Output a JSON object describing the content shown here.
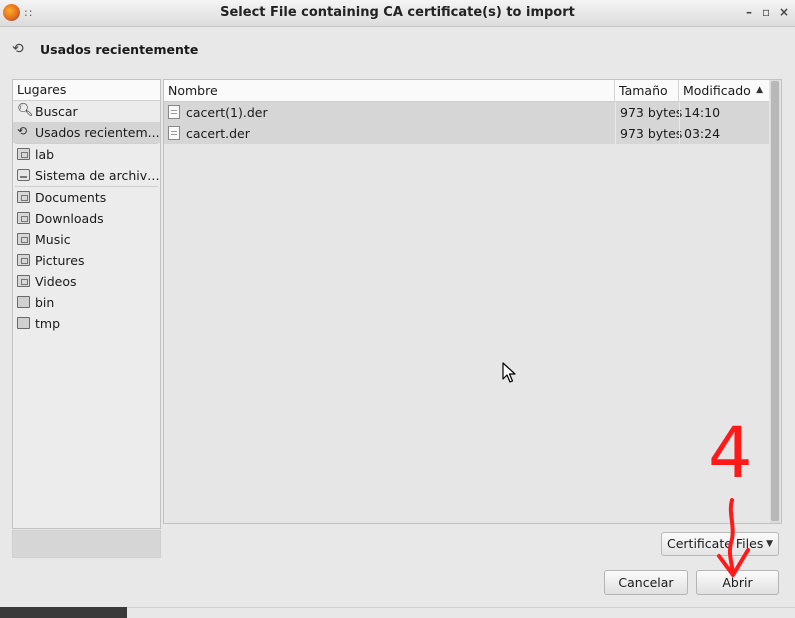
{
  "window": {
    "title": "Select File containing CA certificate(s) to import",
    "grip": "::",
    "controls": {
      "minimize": "–",
      "maximize": "▫",
      "close": "×"
    }
  },
  "location": {
    "icon": "recent-icon",
    "label": "Usados recientemente"
  },
  "places": {
    "header": "Lugares",
    "items": [
      {
        "label": "Buscar",
        "icon": "search-icon"
      },
      {
        "label": "Usados recientem...",
        "icon": "recent-icon",
        "selected": true
      },
      {
        "label": "lab",
        "icon": "home-folder-icon"
      },
      {
        "label": "Sistema de archivos",
        "icon": "drive-icon"
      },
      {
        "label": "Documents",
        "icon": "documents-folder-icon"
      },
      {
        "label": "Downloads",
        "icon": "downloads-folder-icon"
      },
      {
        "label": "Music",
        "icon": "music-folder-icon"
      },
      {
        "label": "Pictures",
        "icon": "pictures-folder-icon"
      },
      {
        "label": "Videos",
        "icon": "videos-folder-icon"
      },
      {
        "label": "bin",
        "icon": "folder-icon"
      },
      {
        "label": "tmp",
        "icon": "folder-icon"
      }
    ]
  },
  "files": {
    "columns": {
      "name": "Nombre",
      "size": "Tamaño",
      "modified": "Modificado"
    },
    "sort_arrow": "▲",
    "rows": [
      {
        "name": "cacert(1).der",
        "size": "973 bytes",
        "modified": "14:10"
      },
      {
        "name": "cacert.der",
        "size": "973 bytes",
        "modified": "03:24"
      }
    ]
  },
  "filter": {
    "value": "Certificate Files",
    "arrow": "▼"
  },
  "buttons": {
    "cancel": "Cancelar",
    "open": "Abrir"
  },
  "annotation": {
    "number": "4",
    "color": "#ff1a1a"
  }
}
